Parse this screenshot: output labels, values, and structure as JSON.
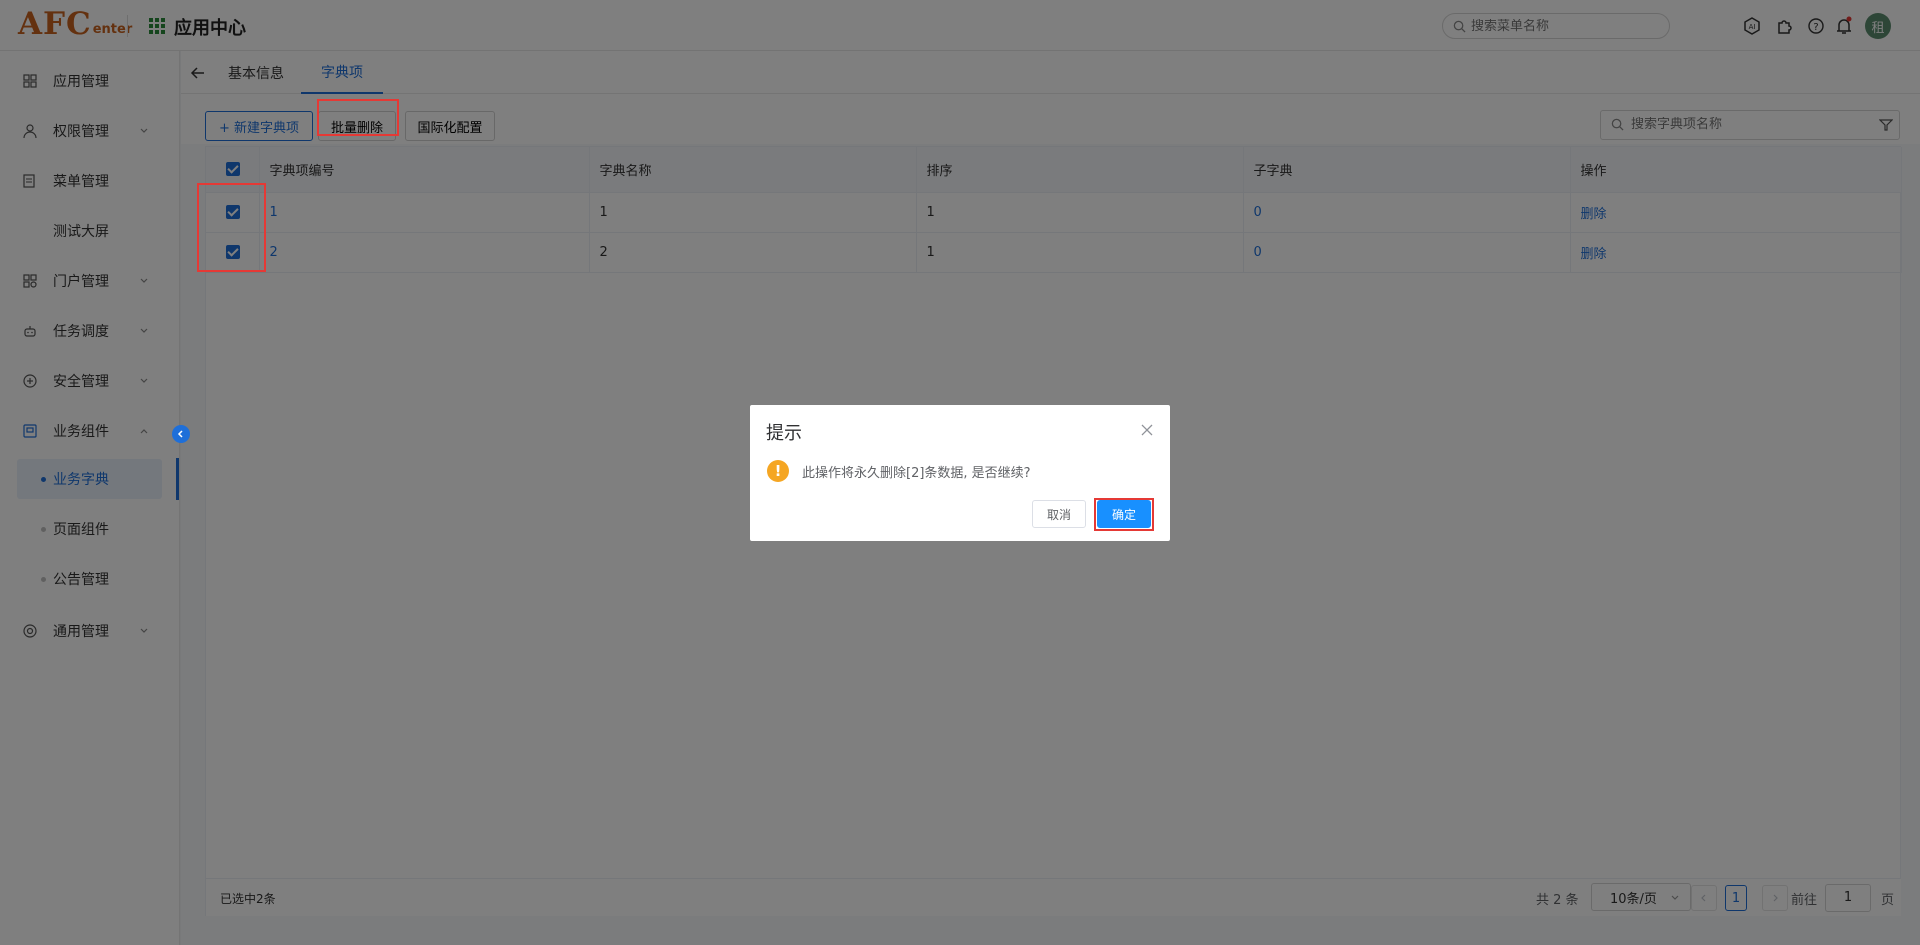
{
  "header": {
    "logo_big": "AFC",
    "logo_small": "enter",
    "app_title": "应用中心",
    "search_placeholder": "搜索菜单名称",
    "avatar_text": "租"
  },
  "sidebar": {
    "items": [
      {
        "label": "应用管理",
        "icon": "apps-grid-icon"
      },
      {
        "label": "权限管理",
        "icon": "user-icon"
      },
      {
        "label": "菜单管理",
        "icon": "document-icon"
      },
      {
        "label": "测试大屏",
        "icon": ""
      },
      {
        "label": "门户管理",
        "icon": "portal-icon"
      },
      {
        "label": "任务调度",
        "icon": "robot-icon"
      },
      {
        "label": "安全管理",
        "icon": "shield-icon"
      },
      {
        "label": "业务组件",
        "icon": "component-icon"
      },
      {
        "label": "通用管理",
        "icon": "settings-icon"
      }
    ],
    "sub_items": [
      {
        "label": "业务字典",
        "active": true
      },
      {
        "label": "页面组件",
        "active": false
      },
      {
        "label": "公告管理",
        "active": false
      }
    ]
  },
  "tabs": [
    {
      "label": "基本信息"
    },
    {
      "label": "字典项"
    }
  ],
  "toolbar": {
    "new_label": "+ 新建字典项",
    "batch_delete_label": "批量删除",
    "i18n_label": "国际化配置",
    "search_placeholder": "搜索字典项名称"
  },
  "table": {
    "columns": [
      "字典项编号",
      "字典名称",
      "排序",
      "子字典",
      "操作"
    ],
    "rows": [
      {
        "code": "1",
        "name": "1",
        "sort": "1",
        "children": "0",
        "action": "删除"
      },
      {
        "code": "2",
        "name": "2",
        "sort": "1",
        "children": "0",
        "action": "删除"
      }
    ]
  },
  "footer": {
    "selected_text": "已选中2条",
    "total_text": "共 2 条",
    "page_size": "10条/页",
    "current_page": "1",
    "goto_prefix": "前往",
    "goto_value": "1",
    "goto_suffix": "页"
  },
  "dialog": {
    "title": "提示",
    "message": "此操作将永久删除[2]条数据, 是否继续?",
    "cancel_label": "取消",
    "confirm_label": "确定"
  },
  "colors": {
    "primary": "#1e6fd9",
    "highlight": "#e53935",
    "warning": "#f5a623"
  }
}
